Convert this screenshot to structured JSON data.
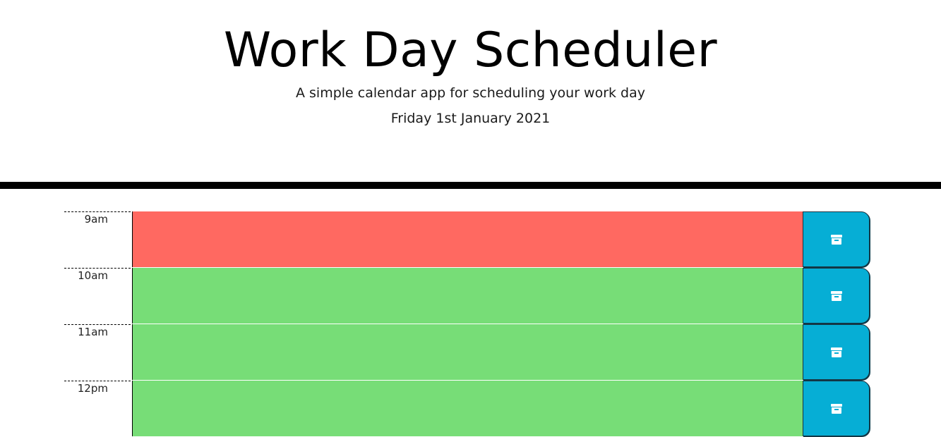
{
  "header": {
    "title": "Work Day Scheduler",
    "subtitle": "A simple calendar app for scheduling your work day",
    "current_day": "Friday 1st January 2021"
  },
  "colors": {
    "present": "#ff6961",
    "future": "#77dd77",
    "past": "#d3d3d3",
    "save_button": "#06aed5",
    "divider": "#000000"
  },
  "timeblocks": [
    {
      "hour": "9am",
      "status": "present",
      "text": "",
      "save_icon": "archive-icon"
    },
    {
      "hour": "10am",
      "status": "future",
      "text": "",
      "save_icon": "archive-icon"
    },
    {
      "hour": "11am",
      "status": "future",
      "text": "",
      "save_icon": "archive-icon"
    },
    {
      "hour": "12pm",
      "status": "future",
      "text": "",
      "save_icon": "archive-icon"
    }
  ]
}
